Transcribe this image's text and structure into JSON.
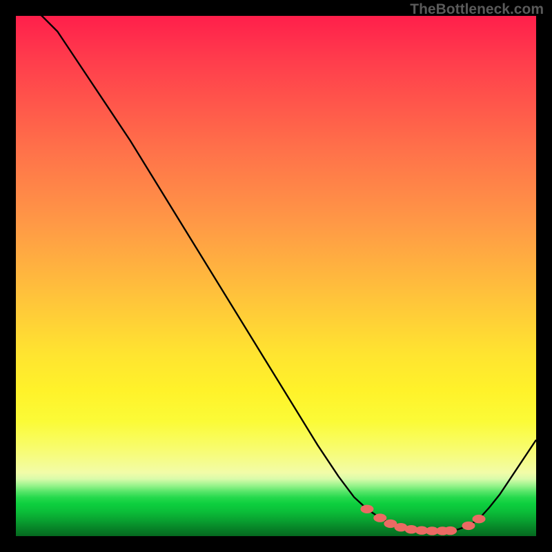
{
  "watermark": "TheBottleneck.com",
  "colors": {
    "curve": "#000000",
    "marker": "#eb6a63",
    "background": "#000000"
  },
  "chart_data": {
    "type": "line",
    "title": "",
    "xlabel": "",
    "ylabel": "",
    "xlim": [
      0,
      100
    ],
    "ylim": [
      0,
      100
    ],
    "x": [
      0,
      2,
      5,
      8,
      10,
      14,
      18,
      22,
      26,
      30,
      34,
      38,
      42,
      46,
      50,
      54,
      58,
      62,
      65,
      67.5,
      70,
      72,
      74,
      76,
      78,
      80,
      82,
      83.5,
      85,
      87,
      89,
      91,
      93,
      95,
      97,
      99,
      100
    ],
    "values": [
      102,
      102,
      100,
      97,
      94,
      88,
      82,
      76,
      69.5,
      63,
      56.5,
      50,
      43.5,
      37,
      30.5,
      24,
      17.5,
      11.5,
      7.5,
      5.2,
      3.5,
      2.4,
      1.7,
      1.3,
      1.1,
      1.0,
      1.0,
      1.05,
      1.3,
      2.0,
      3.3,
      5.5,
      8.0,
      11.0,
      14.0,
      17.0,
      18.5
    ],
    "markers_x": [
      67.5,
      70,
      72,
      74,
      76,
      78,
      80,
      82,
      83.5,
      87,
      89
    ],
    "markers_y": [
      5.2,
      3.5,
      2.4,
      1.7,
      1.3,
      1.1,
      1.0,
      1.0,
      1.05,
      2.0,
      3.3
    ],
    "description": "Bottleneck percentage curve. Y is the mismatch (0 at bottom = ideal). X is an implied hardware pairing axis. The curve starts very high at the left, descends nearly linearly to a wide flat minimum around x=72-85, then rises again toward the right. Salmon-colored oval markers highlight the near-optimal flat region."
  }
}
